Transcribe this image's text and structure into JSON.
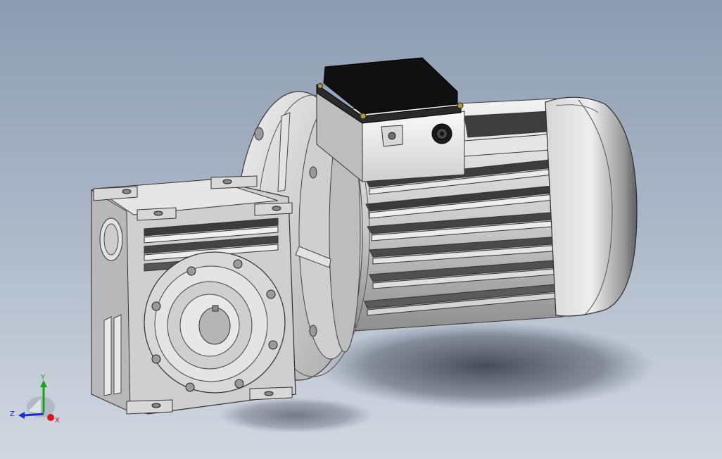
{
  "viewport": {
    "background_top": "#8d9cb2",
    "background_bottom": "#d1d8e1"
  },
  "model": {
    "description_icon": "worm-gear-motor-model",
    "parts": [
      "worm-gearbox",
      "electric-motor",
      "terminal-box",
      "motor-flange",
      "cable-gland",
      "fan-cover"
    ]
  },
  "triad": {
    "x_label": "X",
    "y_label": "Y",
    "z_label": "Z",
    "x_color": "#d8141c",
    "y_color": "#18a418",
    "z_color": "#1a2fd0"
  }
}
